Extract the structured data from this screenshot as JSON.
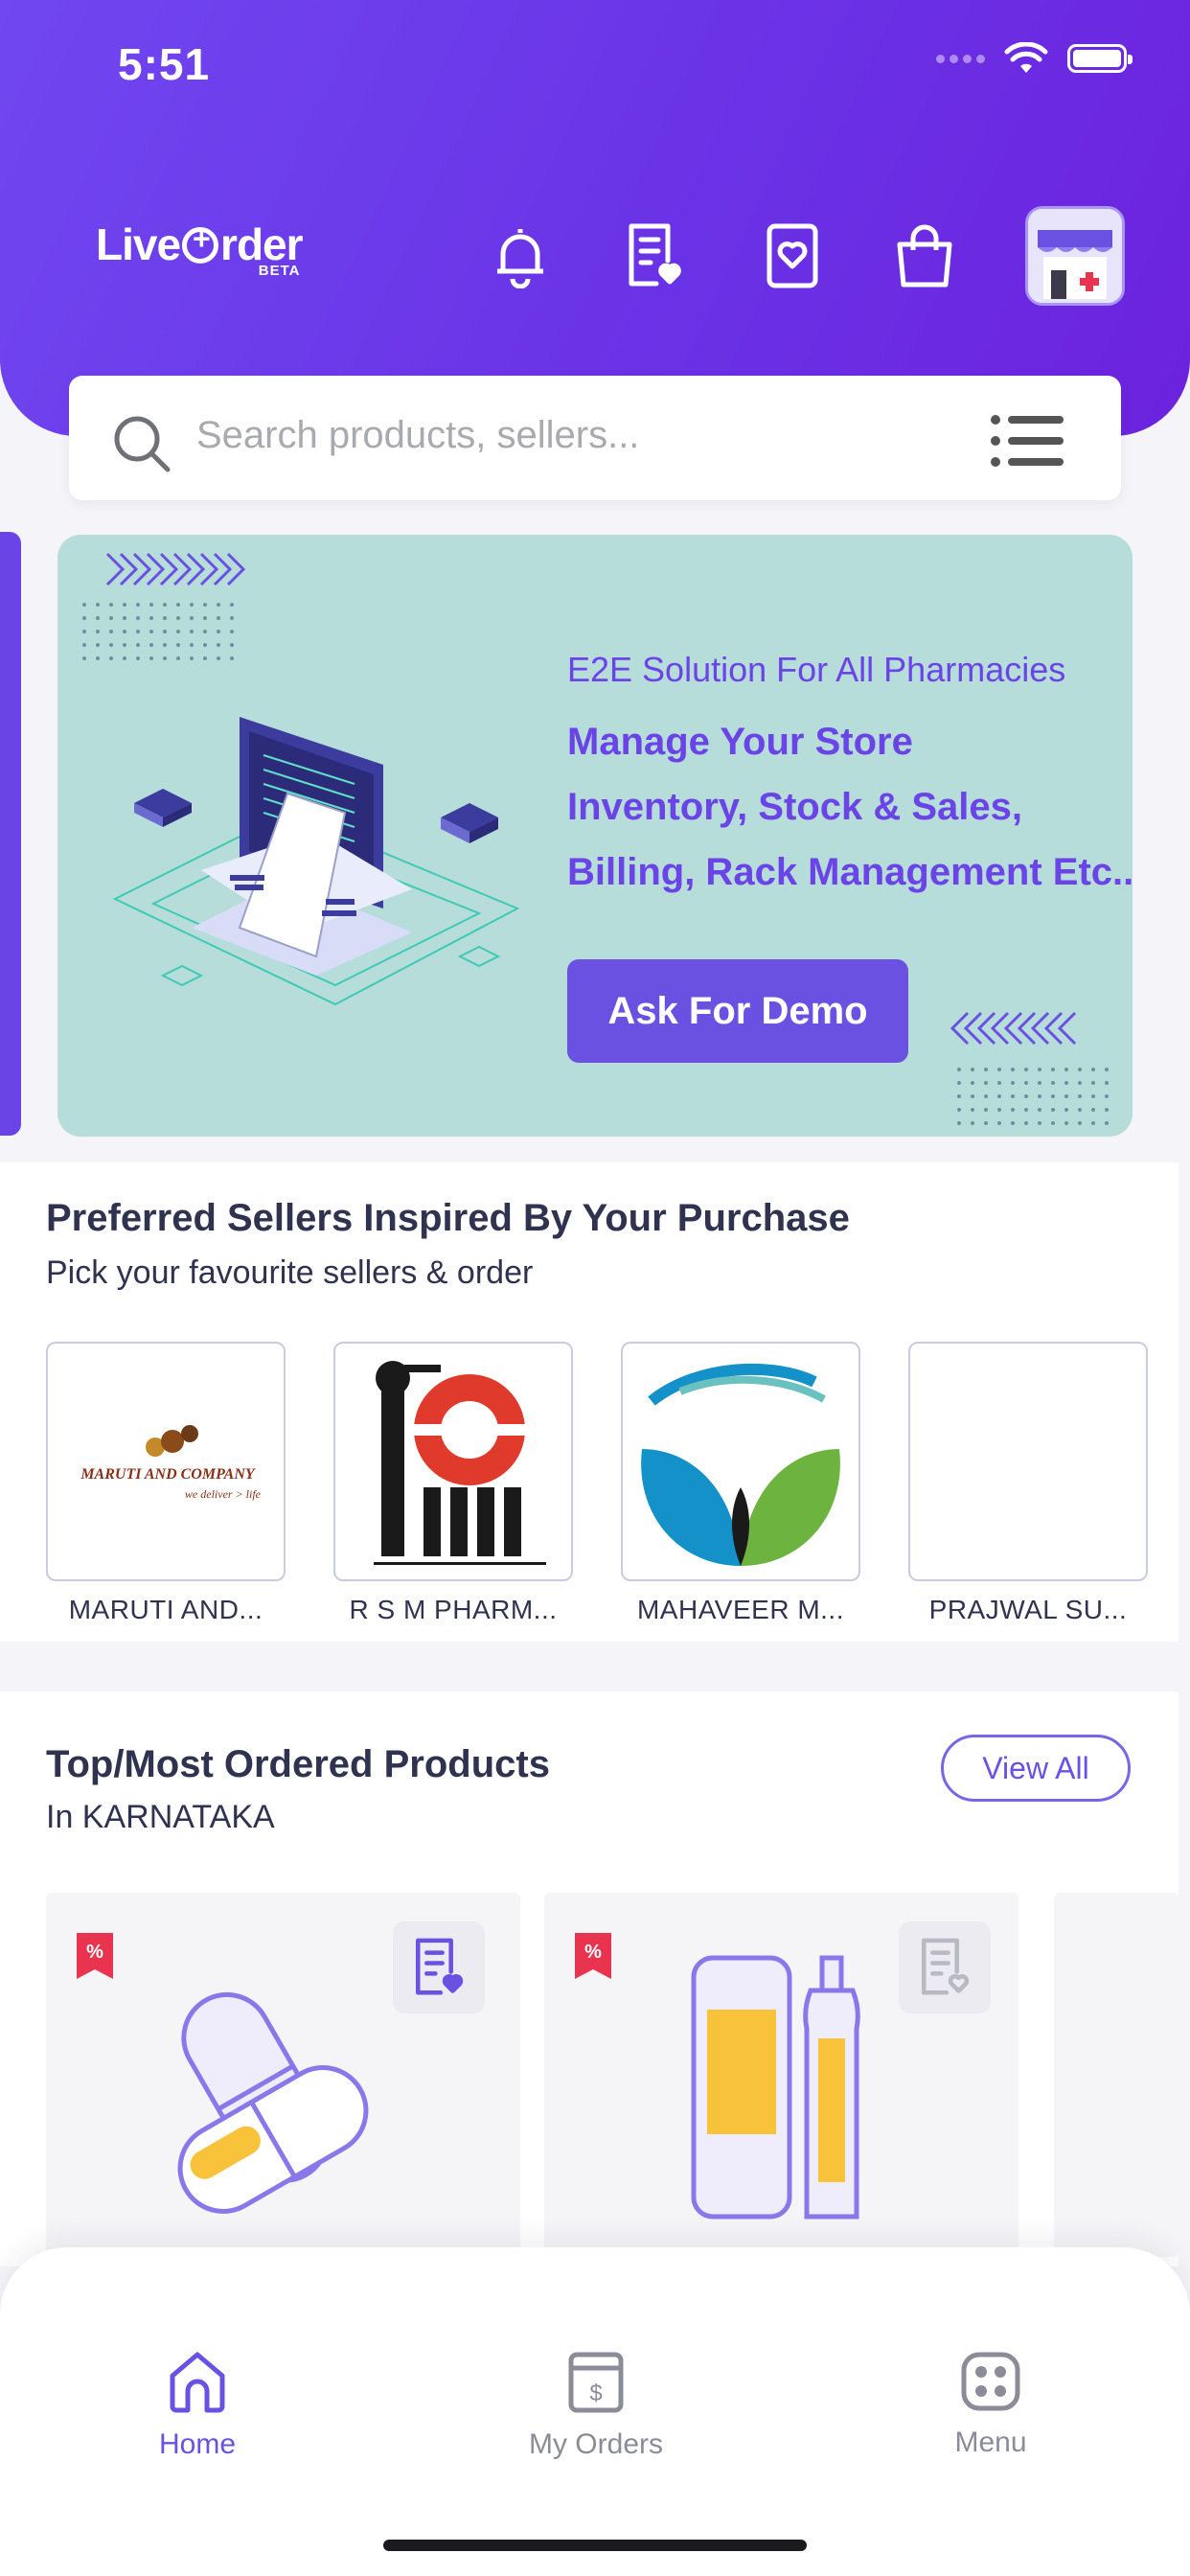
{
  "status_bar": {
    "time": "5:51"
  },
  "header": {
    "logo_text": "Live",
    "logo_text2": "rder",
    "logo_beta": "BETA",
    "icons": [
      "bell-icon",
      "order-list-icon",
      "wishlist-icon",
      "shopping-bag-icon",
      "store-avatar"
    ]
  },
  "search": {
    "placeholder": "Search products, sellers..."
  },
  "banner": {
    "subtitle": "E2E Solution For All Pharmacies",
    "title_lines": [
      "Manage Your Store",
      "Inventory, Stock & Sales,",
      "Billing, Rack Management Etc..."
    ],
    "button_label": "Ask For Demo"
  },
  "preferred_sellers": {
    "title": "Preferred Sellers Inspired By Your Purchase",
    "subtitle": "Pick your favourite sellers & order",
    "sellers": [
      {
        "name": "MARUTI AND...",
        "logo_text": "MARUTI AND COMPANY",
        "logo_tagline": "we deliver > life"
      },
      {
        "name": "R S M PHARM..."
      },
      {
        "name": "MAHAVEER M..."
      },
      {
        "name": "PRAJWAL SU..."
      }
    ]
  },
  "top_products": {
    "title": "Top/Most Ordered Products",
    "subtitle": "In KARNATAKA",
    "view_all_label": "View All",
    "badge_symbol": "%"
  },
  "bottom_nav": {
    "items": [
      {
        "label": "Home",
        "icon": "home-icon",
        "active": true
      },
      {
        "label": "My Orders",
        "icon": "orders-icon",
        "active": false
      },
      {
        "label": "Menu",
        "icon": "menu-grid-icon",
        "active": false
      }
    ]
  },
  "colors": {
    "primary": "#6a44e6",
    "banner_bg": "#b6ddd9",
    "text_dark": "#2f3350",
    "badge_red": "#e8344e"
  }
}
